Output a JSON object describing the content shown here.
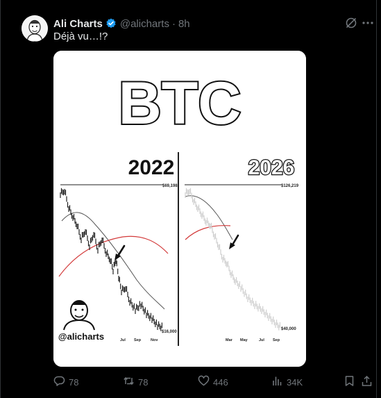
{
  "tweet": {
    "author_name": "Ali Charts",
    "handle": "@alicharts",
    "separator": "·",
    "time": "8h",
    "text": "Déjà vu…!?"
  },
  "media": {
    "title": "BTC",
    "left_panel": {
      "year": "2022",
      "top_price": "$69,198",
      "bottom_price": "$16,000",
      "x_ticks": [
        "Jul",
        "Sep",
        "Nov"
      ]
    },
    "right_panel": {
      "year": "2026",
      "top_price": "$126,219",
      "bottom_price": "$40,000",
      "x_ticks": [
        "Mar",
        "May",
        "Jul",
        "Sep"
      ]
    },
    "watermark": "@alicharts"
  },
  "actions": {
    "replies": "78",
    "reposts": "78",
    "likes": "446",
    "views": "34K"
  },
  "icons": {
    "verified": "verified-badge-icon",
    "grok": "grok-icon",
    "more": "more-icon",
    "reply": "reply-icon",
    "repost": "repost-icon",
    "like": "heart-icon",
    "views": "views-icon",
    "bookmark": "bookmark-icon",
    "share": "share-icon"
  },
  "colors": {
    "background": "#000000",
    "text": "#e7e9ea",
    "muted": "#71767b",
    "verified": "#1d9bf0",
    "moving_average_red": "#d33a3a"
  }
}
